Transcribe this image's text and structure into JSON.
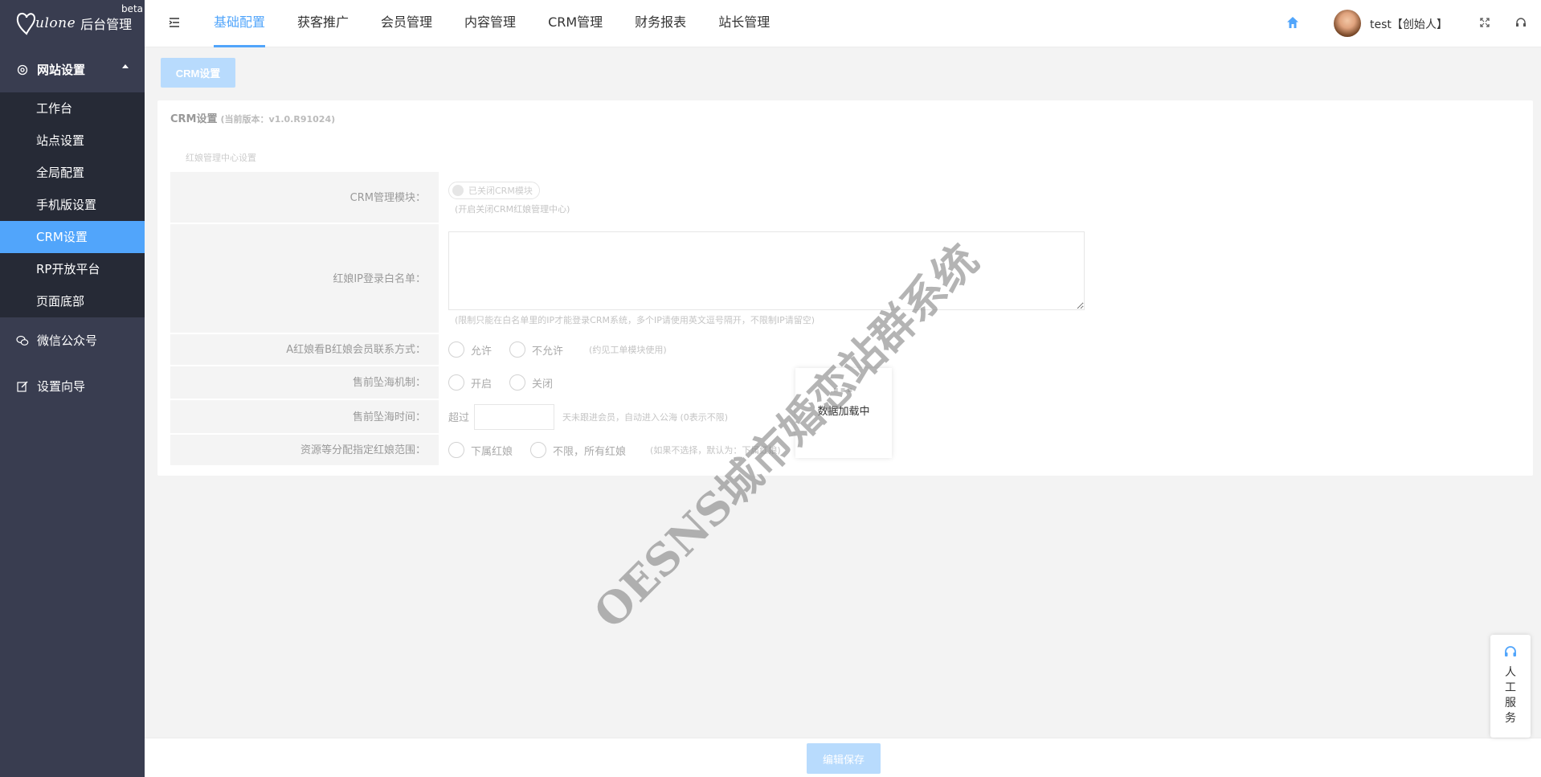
{
  "logo": {
    "script": "ulone",
    "admin_label": "后台管理",
    "badge": "beta"
  },
  "sidebar": {
    "group_site": "网站设置",
    "items": [
      {
        "label": "工作台"
      },
      {
        "label": "站点设置"
      },
      {
        "label": "全局配置"
      },
      {
        "label": "手机版设置"
      },
      {
        "label": "CRM设置"
      },
      {
        "label": "RP开放平台"
      },
      {
        "label": "页面底部"
      }
    ],
    "group_wechat": "微信公众号",
    "group_wizard": "设置向导"
  },
  "topbar": {
    "tabs": [
      {
        "label": "基础配置"
      },
      {
        "label": "获客推广"
      },
      {
        "label": "会员管理"
      },
      {
        "label": "内容管理"
      },
      {
        "label": "CRM管理"
      },
      {
        "label": "财务报表"
      },
      {
        "label": "站长管理"
      }
    ],
    "user": "test【创始人】"
  },
  "breadcrumb": {
    "tab": "CRM设置"
  },
  "panel": {
    "title": "CRM设置",
    "version": "(当前版本：v1.0.R91024)",
    "section": "红娘管理中心设置"
  },
  "form": {
    "crm_module": {
      "label": "CRM管理模块：",
      "toggle": "已关闭CRM模块",
      "hint": "(开启关闭CRM红娘管理中心)"
    },
    "ip_whitelist": {
      "label": "红娘IP登录白名单：",
      "value": "",
      "hint": "(限制只能在白名单里的IP才能登录CRM系统，多个IP请使用英文逗号隔开，不限制IP请留空)"
    },
    "contact_view": {
      "label": "A红娘看B红娘会员联系方式：",
      "opt1": "允许",
      "opt2": "不允许",
      "hint": "(约见工单模块使用)"
    },
    "presale_mechanism": {
      "label": "售前坠海机制：",
      "opt1": "开启",
      "opt2": "关闭"
    },
    "presale_time": {
      "label": "售前坠海时间：",
      "prefix": "超过",
      "value": "",
      "hint": "天未跟进会员，自动进入公海 (0表示不限)"
    },
    "resource_range": {
      "label": "资源等分配指定红娘范围：",
      "opt1": "下属红娘",
      "opt2": "不限，所有红娘",
      "hint": "(如果不选择，默认为：下属红娘)"
    }
  },
  "loading": {
    "text": "数据加载中"
  },
  "watermark": "OESNS城市婚恋站群系统",
  "footer": {
    "save": "编辑保存"
  },
  "service": {
    "chars": [
      "人",
      "工",
      "服",
      "务"
    ]
  },
  "colors": {
    "sidebar": "#393d50",
    "subnav": "#262a36",
    "accent": "#51a5fb",
    "disabled_btn": "#b8dbfd"
  }
}
